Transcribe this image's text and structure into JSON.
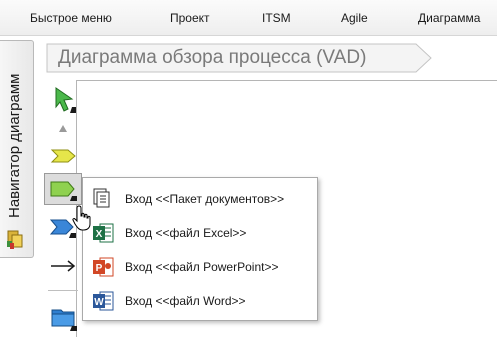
{
  "menubar": {
    "items": [
      "Быстрое меню",
      "Проект",
      "ITSM",
      "Agile",
      "Диаграмма"
    ]
  },
  "navigator": {
    "label": "Навигатор диаграмм"
  },
  "diagram": {
    "title": "Диаграмма обзора процесса (VAD)"
  },
  "toolbar": {
    "tools": [
      "select-arrow-icon",
      "small-triangle-icon",
      "process-chevron-icon",
      "process-rect-icon",
      "flow-chevron-icon",
      "connector-arrow-icon",
      "folder-icon"
    ]
  },
  "popup": {
    "items": [
      {
        "label": "Вход <<Пакет документов>>",
        "icon": "document-package-icon"
      },
      {
        "label": "Вход <<файл Excel>>",
        "icon": "excel-icon"
      },
      {
        "label": "Вход <<файл PowerPoint>>",
        "icon": "powerpoint-icon"
      },
      {
        "label": "Вход <<файл Word>>",
        "icon": "word-icon"
      }
    ]
  },
  "colors": {
    "excel": "#1e7145",
    "powerpoint": "#d24726",
    "word": "#2b579a",
    "process_green": "#8fd14f",
    "chevron_yellow": "#e6e64a",
    "flow_blue": "#3a86d8"
  }
}
